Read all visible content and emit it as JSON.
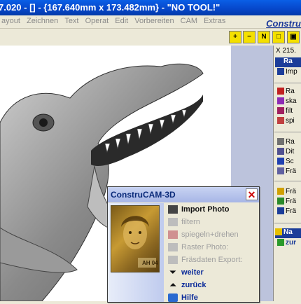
{
  "window": {
    "title": "7.020 - [] - {167.640mm x 173.482mm} - \"NO TOOL!\""
  },
  "menu": [
    "ayout",
    "Zeichnen",
    "Text",
    "Operat",
    "Edit",
    "Vorbereiten",
    "CAM",
    "Extras"
  ],
  "brand": "Constru",
  "toolbar": {
    "buttons": [
      "zoom-in-icon",
      "zoom-out-icon",
      "zoom-fit-icon",
      "zoom-window-icon",
      "zoom-all-icon"
    ]
  },
  "panel": {
    "coord": "X 215.",
    "items": [
      {
        "label": "Ra",
        "icon": "header-icon",
        "highlight": true
      },
      {
        "label": "Imp",
        "icon": "import-icon"
      },
      {
        "label": "Ra",
        "icon": "raster-icon"
      },
      {
        "label": "ska",
        "icon": "scale-icon"
      },
      {
        "label": "filt",
        "icon": "filter-icon"
      },
      {
        "label": "spi",
        "icon": "mirror-icon"
      },
      {
        "label": "Ra",
        "icon": "raster-icon"
      },
      {
        "label": "Dit",
        "icon": "dither-icon"
      },
      {
        "label": "Sc",
        "icon": "scan-icon"
      },
      {
        "label": "Frä",
        "icon": "mill-icon"
      },
      {
        "label": "Frä",
        "icon": "tool-icon"
      },
      {
        "label": "Frä",
        "icon": "mill-icon"
      },
      {
        "label": "Frä",
        "icon": "mill-icon"
      },
      {
        "label": "Na",
        "icon": "next-icon",
        "highlight": true
      },
      {
        "label": "zur",
        "icon": "check-icon"
      }
    ]
  },
  "dialog": {
    "title": "ConstruCAM-3D",
    "photo_caption": "AH 04",
    "items": [
      {
        "label": "Import Photo",
        "state": "active"
      },
      {
        "label": "filtern",
        "state": "disabled"
      },
      {
        "label": "spiegeln+drehen",
        "state": "disabled"
      },
      {
        "label": "Raster Photo:",
        "state": "disabled"
      },
      {
        "label": "Fräsdaten Export:",
        "state": "disabled"
      },
      {
        "label": "weiter",
        "state": "nav"
      },
      {
        "label": "zurück",
        "state": "nav"
      },
      {
        "label": "Hilfe",
        "state": "nav"
      }
    ]
  }
}
